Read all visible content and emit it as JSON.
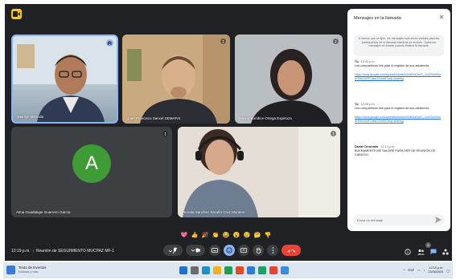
{
  "meeting": {
    "time": "12:19 p.m.",
    "separator": "|",
    "name": "Reunión de SEGUIMIENTO MUCPAZ MF-1"
  },
  "participants": [
    {
      "name": "Marilyn Miranda"
    },
    {
      "name": "Juan Francisco Sancel SEMAFAI"
    },
    {
      "name": "Alexia Eurídice Ortega Espinoza"
    },
    {
      "name": "Alma Guadalupe Guerrero García",
      "avatar_letter": "A",
      "avatar_color": "#3f9b35"
    },
    {
      "name": "Renata Sánchez Serafín Cruz Morales"
    }
  ],
  "chat": {
    "title": "Mensajes en la llamada",
    "close_icon": "close-icon",
    "info": "A menos que se fijen, los mensajes solo serán visibles para los participantes de la llamada mientras se reciben. Todos los mensajes se borran cuando finaliza la llamada.",
    "messages": [
      {
        "sender": "Tú",
        "time": "12:03 p.m.",
        "text": "Les compartimos link para el registro de sus asistencia",
        "link": "https://docs.google.com/spreadsheets/d/1Mt0Ja2ssG_XcIlZSw9iXnmY5hXn1PCdbw7G/edit?usp=sharing"
      },
      {
        "sender": "Tú",
        "time": "12:05 p.m.",
        "text": "Les compartimos link para el registro de sus asistencia",
        "link": "https://docs.google.com/spreadsheets/d/1Mt0Ja2ssG_XcIlZSw9iXnmY5hXn1PCdbw7G/edit?usp=sharing"
      },
      {
        "sender": "David Coronado",
        "time": "12:14 p.m.",
        "text": "BUENAMENTE ME SALDRÉ PARA VER DE REUNIÓN DE CABILDO",
        "link": ""
      }
    ],
    "input_placeholder": "Envía un mensaje",
    "send_icon": "send-icon"
  },
  "reactions": [
    "💖",
    "👍",
    "🎉",
    "👏",
    "😂",
    "😮",
    "😢",
    "🤔",
    "👎"
  ],
  "controls": {
    "colors": {
      "red": "#ea4335",
      "blue": "#8ab4f8",
      "gray": "#3c4043"
    },
    "people_count": "5"
  },
  "taskbar": {
    "weather_title": "Texto de Eventos",
    "weather_sub": "Noticias y más",
    "language": "ESP",
    "clock_time": "12:19 p.m.",
    "clock_date": "23/06/2024"
  }
}
